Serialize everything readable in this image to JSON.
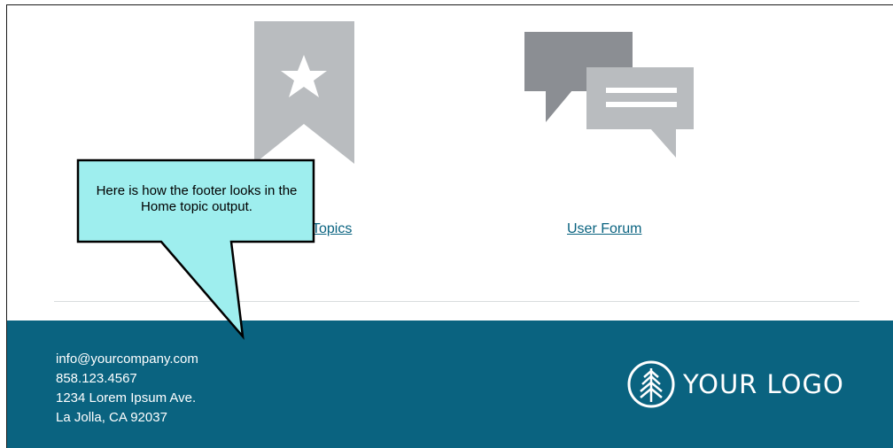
{
  "topics_link": {
    "label": "Topics",
    "icon": "bookmark-star-icon"
  },
  "forum_link": {
    "label": "User Forum",
    "icon": "chat-bubbles-icon"
  },
  "callout": {
    "text": "Here is how the footer looks in the Home topic output."
  },
  "footer": {
    "email": "info@yourcompany.com",
    "phone": "858.123.4567",
    "address_line1": "1234 Lorem Ipsum Ave.",
    "address_line2": "La Jolla, CA 92037",
    "logo_text": "YOUR LOGO",
    "logo_icon": "pine-tree-icon"
  },
  "colors": {
    "footer_bg": "#0a6380",
    "link": "#0a6380",
    "icon_gray": "#b9bcbf",
    "icon_dark_gray": "#8b8e93",
    "callout_fill": "#9eeeee"
  }
}
